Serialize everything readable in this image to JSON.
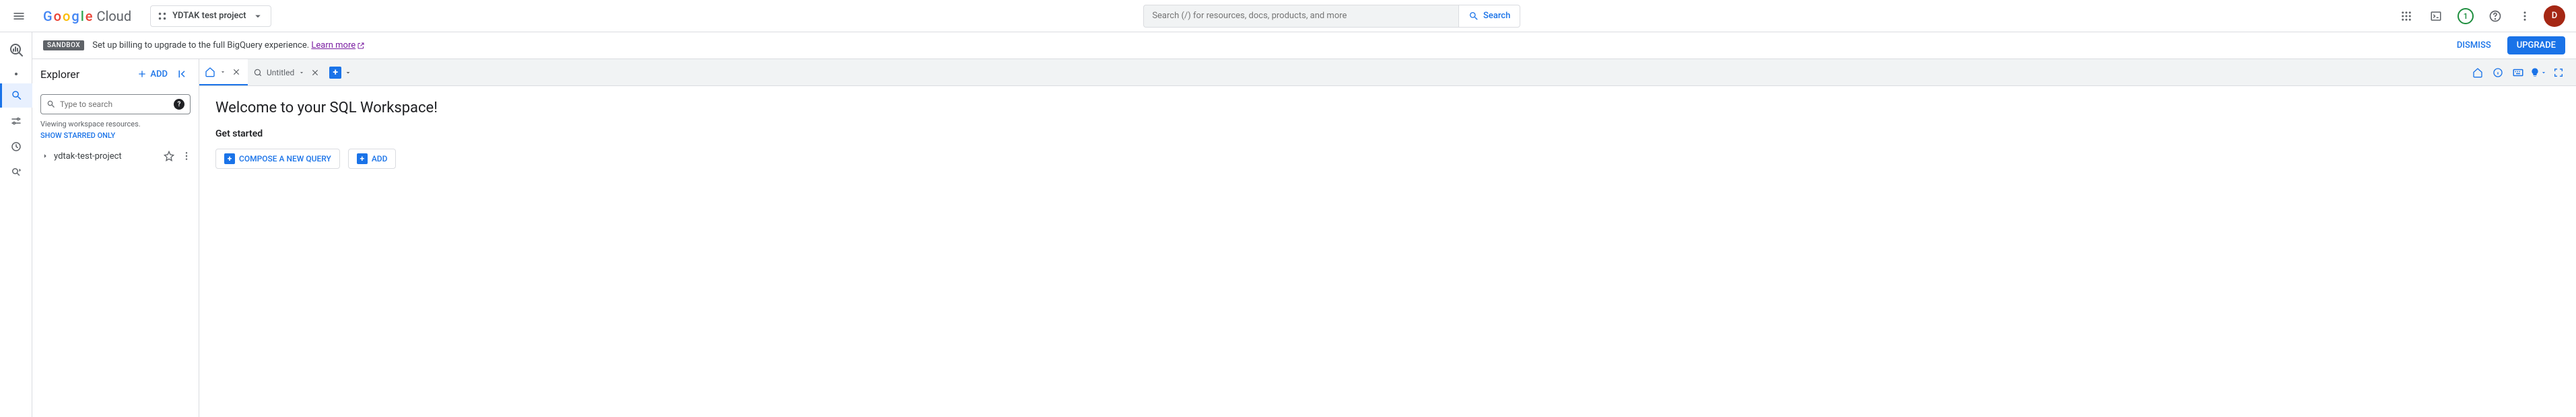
{
  "header": {
    "brand_cloud": "Cloud",
    "project_name": "YDTAK test project",
    "search_placeholder": "Search (/) for resources, docs, products, and more",
    "search_button": "Search",
    "free_trial_count": "1",
    "avatar_letter": "D"
  },
  "banner": {
    "sandbox_chip": "SANDBOX",
    "text": "Set up billing to upgrade to the full BigQuery experience.",
    "learn_more": "Learn more",
    "dismiss": "DISMISS",
    "upgrade": "UPGRADE"
  },
  "explorer": {
    "title": "Explorer",
    "add_label": "ADD",
    "search_placeholder": "Type to search",
    "viewing_text": "Viewing workspace resources.",
    "show_starred": "SHOW STARRED ONLY",
    "project_node": "ydtak-test-project"
  },
  "tabs": {
    "untitled_label": "Untitled"
  },
  "welcome": {
    "heading": "Welcome to your SQL Workspace!",
    "get_started": "Get started",
    "compose": "COMPOSE A NEW QUERY",
    "add": "ADD"
  }
}
